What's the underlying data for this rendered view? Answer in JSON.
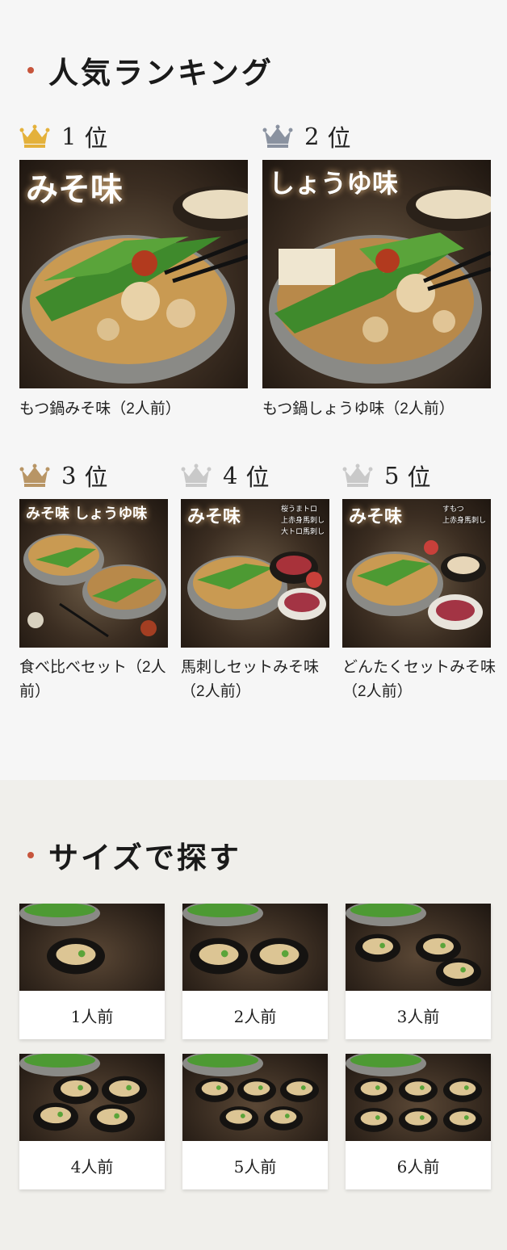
{
  "colors": {
    "accent_dot": "#c7553c",
    "gold": "#e4b13b",
    "silver": "#8a92a0",
    "bronze": "#b89565",
    "gray_crown": "#c9c9c9"
  },
  "ranking": {
    "title": "人気ランキング",
    "items": [
      {
        "rank": "1",
        "rank_suffix": "位",
        "crown": "gold-crown-icon",
        "name": "もつ鍋みそ味（2人前）",
        "overlay": "みそ味"
      },
      {
        "rank": "2",
        "rank_suffix": "位",
        "crown": "silver-crown-icon",
        "name": "もつ鍋しょうゆ味（2人前）",
        "overlay": "しょうゆ味"
      },
      {
        "rank": "3",
        "rank_suffix": "位",
        "crown": "bronze-crown-icon",
        "name": "食べ比べセット（2人前）",
        "overlay": "みそ味 しょうゆ味"
      },
      {
        "rank": "4",
        "rank_suffix": "位",
        "crown": "gray-crown-icon",
        "name": "馬刺しセットみそ味（2人前）",
        "overlay": "みそ味",
        "overlay_sub": [
          "桜うまトロ",
          "上赤身馬刺し",
          "大トロ馬刺し"
        ]
      },
      {
        "rank": "5",
        "rank_suffix": "位",
        "crown": "gray-crown-icon",
        "name": "どんたくセットみそ味（2人前）",
        "overlay": "みそ味",
        "overlay_sub": [
          "すもつ",
          "上赤身馬刺し"
        ]
      }
    ]
  },
  "size": {
    "title": "サイズで探す",
    "items": [
      {
        "label": "1人前",
        "bowls": 1
      },
      {
        "label": "2人前",
        "bowls": 2
      },
      {
        "label": "3人前",
        "bowls": 3
      },
      {
        "label": "4人前",
        "bowls": 4
      },
      {
        "label": "5人前",
        "bowls": 5
      },
      {
        "label": "6人前",
        "bowls": 6
      }
    ]
  }
}
